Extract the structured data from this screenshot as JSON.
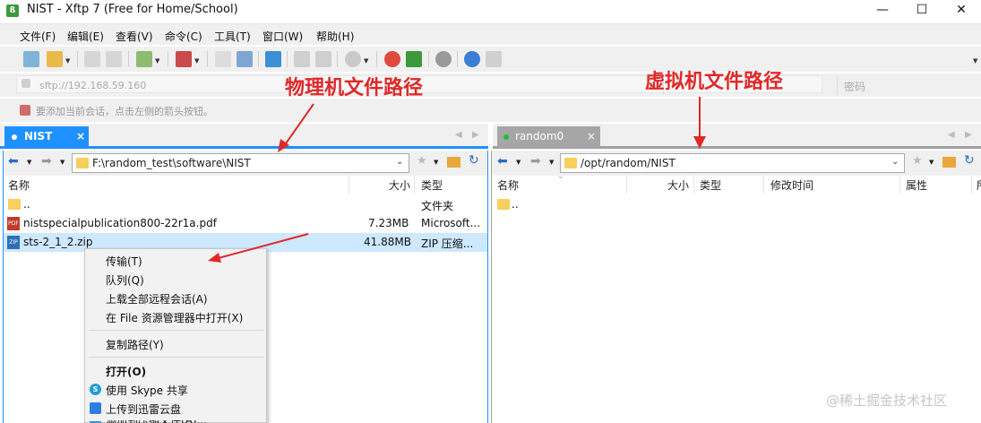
{
  "window": {
    "title": "NIST - Xftp 7 (Free for Home/School)",
    "app_icon_text": "ß",
    "minimize": "—",
    "maximize": "☐",
    "close": "✕"
  },
  "menu": [
    "文件(F)",
    "编辑(E)",
    "查看(V)",
    "命令(C)",
    "工具(T)",
    "窗口(W)",
    "帮助(H)"
  ],
  "address": {
    "value": "sftp://192.168.59.160",
    "password_placeholder": "密码"
  },
  "hint": "要添加当前会话，点击左侧的箭头按钮。",
  "left_tab": {
    "label": "NIST",
    "close": "×"
  },
  "right_tab": {
    "label": "random0",
    "close": "×"
  },
  "left_path": "F:\\random_test\\software\\NIST",
  "right_path": "/opt/random/NIST",
  "left_columns": {
    "name": "名称",
    "size": "大小",
    "type": "类型"
  },
  "right_columns": {
    "name": "名称",
    "size": "大小",
    "type": "类型",
    "modified": "修改时间",
    "attr": "属性",
    "owner": "所"
  },
  "left_files": [
    {
      "name": "..",
      "size": "",
      "type": "文件夹"
    },
    {
      "name": "nistspecialpublication800-22r1a.pdf",
      "size": "7.23MB",
      "type": "Microsoft..."
    },
    {
      "name": "sts-2_1_2.zip",
      "size": "41.88MB",
      "type": "ZIP 压缩..."
    }
  ],
  "right_files": [
    {
      "name": ".."
    }
  ],
  "context_menu": {
    "transfer": "传输(T)",
    "queue": "队列(Q)",
    "upload_all": "上载全部远程会话(A)",
    "open_in_explorer": "在 File 资源管理器中打开(X)",
    "copy_path": "复制路径(Y)",
    "open": "打开(O)",
    "skype": "使用 Skype 共享",
    "xunlei": "上传到迅雷云盘",
    "partial": "添加到压缩文件(A)..."
  },
  "annotations": {
    "left": "物理机文件路径",
    "right": "虚拟机文件路径"
  },
  "watermark": "@稀土掘金技术社区",
  "colors": {
    "accent": "#1e90ff",
    "annotation": "#e02828",
    "selection": "#cde8ff"
  }
}
